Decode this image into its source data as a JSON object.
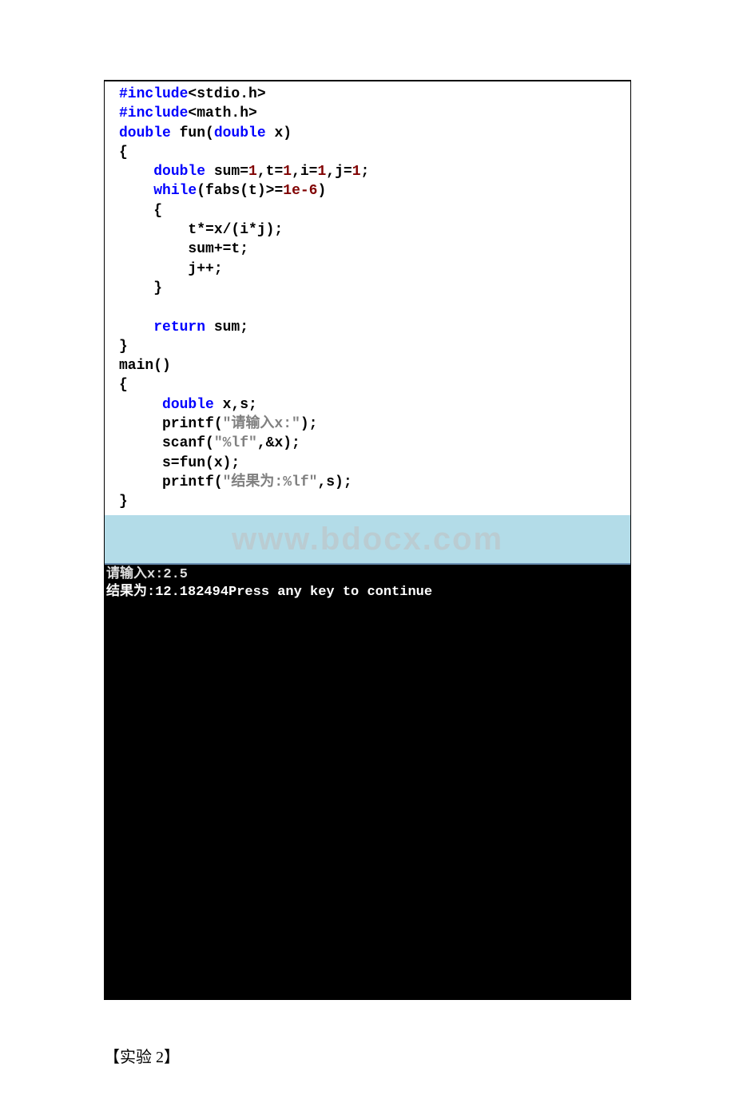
{
  "code": {
    "l1a": "#include",
    "l1b": "<stdio.h>",
    "l2a": "#include",
    "l2b": "<math.h>",
    "l3a": "double",
    "l3b": " fun(",
    "l3c": "double",
    "l3d": " x)",
    "l4": "{",
    "l5a": "    ",
    "l5b": "double",
    "l5c": " sum=",
    "l5d": "1",
    "l5e": ",t=",
    "l5f": "1",
    "l5g": ",i=",
    "l5h": "1",
    "l5i": ",j=",
    "l5j": "1",
    "l5k": ";",
    "l6a": "    ",
    "l6b": "while",
    "l6c": "(fabs(t)>=",
    "l6d": "1e-6",
    "l6e": ")",
    "l7": "    {",
    "l8": "        t*=x/(i*j);",
    "l9": "        sum+=t;",
    "l10": "        j++;",
    "l11": "    }",
    "l12": "",
    "l13a": "    ",
    "l13b": "return",
    "l13c": " sum;",
    "l14": "}",
    "l15": "main()",
    "l16": "{",
    "l17a": "     ",
    "l17b": "double",
    "l17c": " x,s;",
    "l18a": "     printf(",
    "l18b": "\"请输入x:\"",
    "l18c": ");",
    "l19a": "     scanf(",
    "l19b": "\"%lf\"",
    "l19c": ",&x);",
    "l20": "     s=fun(x);",
    "l21a": "     printf(",
    "l21b": "\"结果为:%lf\"",
    "l21c": ",s);",
    "l22": "}"
  },
  "watermark": "www.bdocx.com",
  "console": {
    "line1": "请输入x:2.5",
    "line2": "结果为:12.182494Press any key to continue"
  },
  "footer": "【实验 2】"
}
